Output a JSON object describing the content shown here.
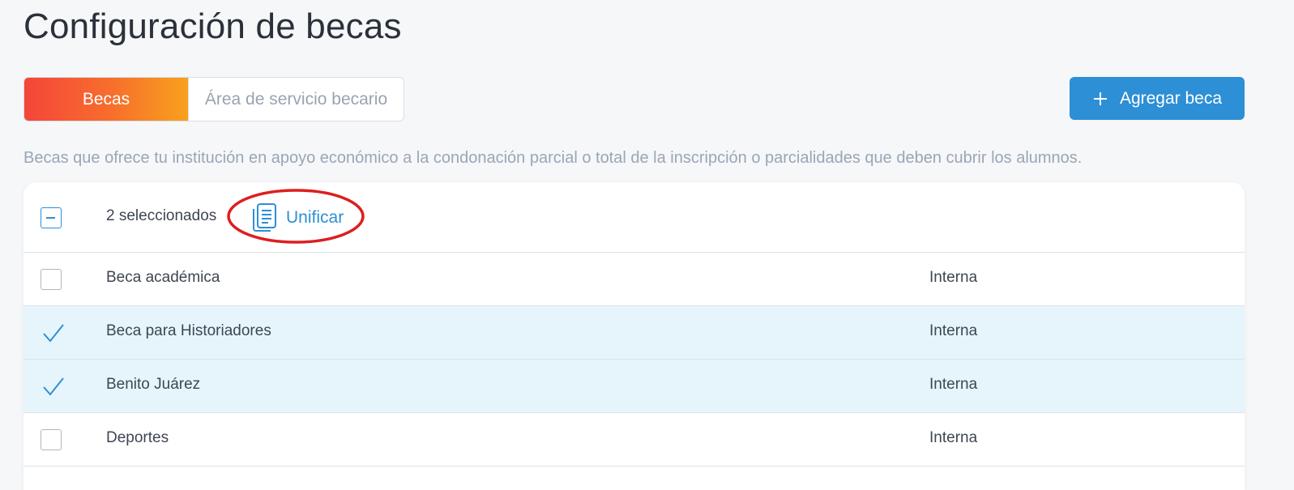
{
  "page": {
    "title": "Configuración de becas",
    "description": "Becas que ofrece tu institución en apoyo económico a la condonación parcial o total de la inscripción o parcialidades que deben cubrir los alumnos."
  },
  "tabs": [
    {
      "label": "Becas",
      "active": true
    },
    {
      "label": "Área de servicio becario",
      "active": false
    }
  ],
  "actions": {
    "add_label": "Agregar beca",
    "add_icon": "plus-icon"
  },
  "toolbar": {
    "selected_count": "2 seleccionados",
    "unify_label": "Unificar",
    "unify_icon": "copy-document-icon",
    "highlight_color": "#dc1f1f"
  },
  "rows": [
    {
      "name": "Beca académica",
      "type": "Interna",
      "selected": false
    },
    {
      "name": "Beca para Historiadores",
      "type": "Interna",
      "selected": true
    },
    {
      "name": "Benito Juárez",
      "type": "Interna",
      "selected": true
    },
    {
      "name": "Deportes",
      "type": "Interna",
      "selected": false
    }
  ],
  "colors": {
    "accent": "#2d8fd5",
    "tab_gradient_start": "#f4453a",
    "tab_gradient_end": "#f8a11f",
    "selected_row_bg": "#e6f5fc"
  }
}
